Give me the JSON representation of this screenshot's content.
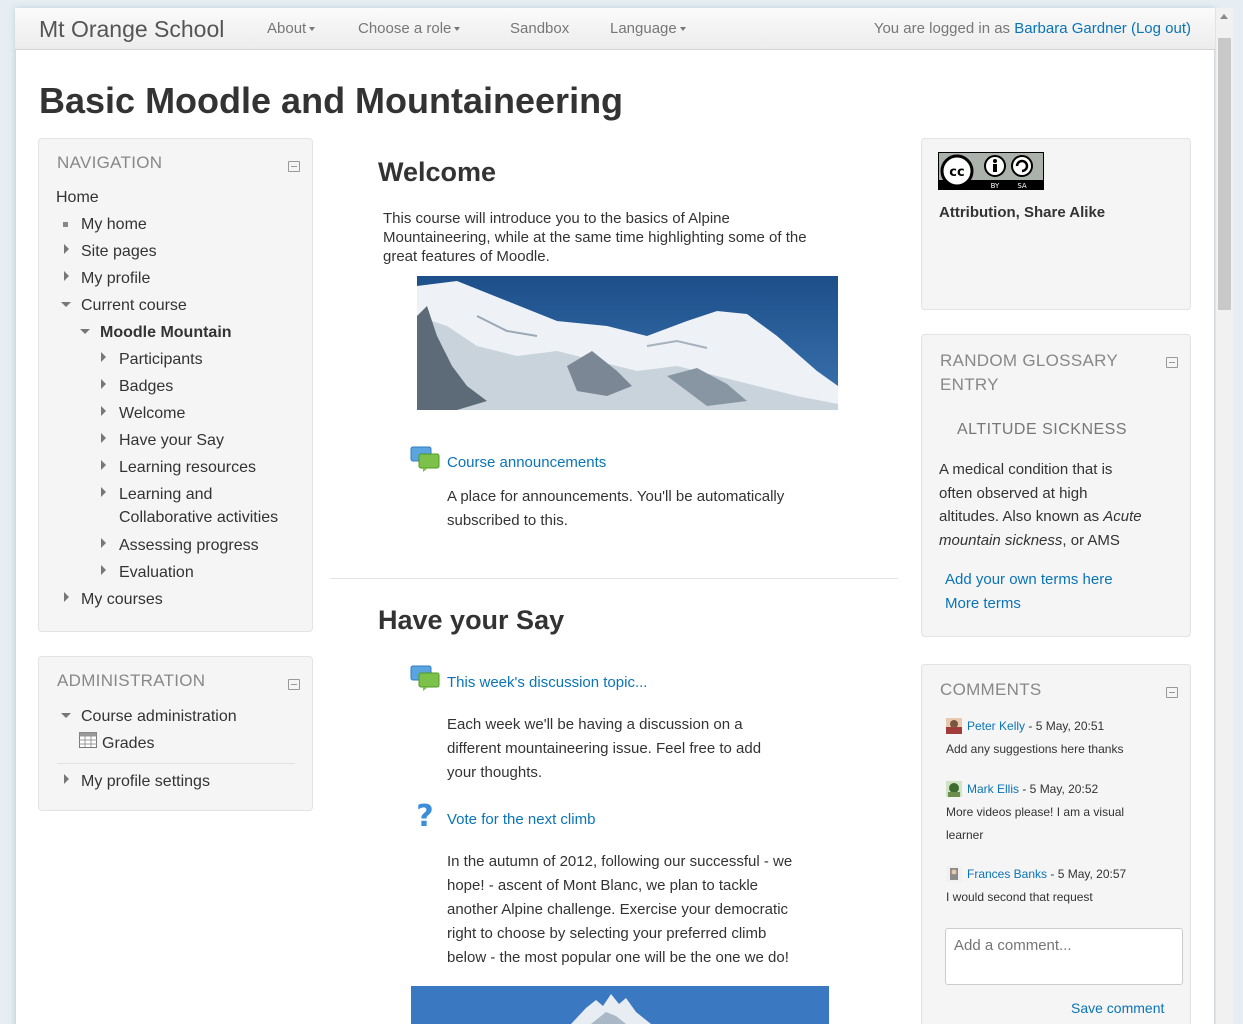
{
  "navbar": {
    "brand": "Mt Orange School",
    "items": [
      {
        "label": "About",
        "dropdown": true
      },
      {
        "label": "Choose a role",
        "dropdown": true
      },
      {
        "label": "Sandbox",
        "dropdown": false
      },
      {
        "label": "Language",
        "dropdown": true
      }
    ],
    "login_prefix": "You are logged in as ",
    "login_user": "Barbara Gardner",
    "logout": "(Log out)"
  },
  "page_title": "Basic Moodle and Mountaineering",
  "navigation": {
    "title": "NAVIGATION",
    "home": "Home",
    "items": {
      "my_home": "My home",
      "site_pages": "Site pages",
      "my_profile": "My profile",
      "current_course": "Current course",
      "course": "Moodle Mountain",
      "participants": "Participants",
      "badges": "Badges",
      "welcome": "Welcome",
      "have_your_say": "Have your Say",
      "learning_resources": "Learning resources",
      "learning_and_1": "Learning and",
      "learning_and_2": "Collaborative activities",
      "assessing_progress": "Assessing progress",
      "evaluation": "Evaluation",
      "my_courses": "My courses"
    }
  },
  "administration": {
    "title": "ADMINISTRATION",
    "course_admin": "Course administration",
    "grades": "Grades",
    "profile_settings": "My profile settings"
  },
  "welcome_section": {
    "title": "Welcome",
    "text_1": "This course will introduce you to the basics of Alpine",
    "text_2": "Mountaineering, while at the same time highlighting some of the",
    "text_3": "great features of Moodle.",
    "announcements_link": "Course announcements",
    "announcements_desc_1": "A place for announcements. You'll be automatically",
    "announcements_desc_2": "subscribed to this."
  },
  "say_section": {
    "title": "Have your Say",
    "discussion_link": "This week's discussion topic...",
    "discussion_desc_1": "Each week we'll be having a discussion on a",
    "discussion_desc_2": "different mountaineering issue. Feel free to add",
    "discussion_desc_3": "your thoughts.",
    "vote_link": "Vote for the next climb",
    "vote_desc_1": "In the autumn of 2012, following our successful - we",
    "vote_desc_2": "hope! - ascent of Mont Blanc, we plan to tackle",
    "vote_desc_3": "another Alpine challenge. Exercise your democratic",
    "vote_desc_4": "right to choose by selecting your preferred climb",
    "vote_desc_5": "below - the most popular one will be the one we do!"
  },
  "license": {
    "badge_letters": "cc BY SA",
    "caption": "Attribution, Share Alike"
  },
  "glossary": {
    "title_1": "RANDOM GLOSSARY",
    "title_2": "ENTRY",
    "term": "ALTITUDE SICKNESS",
    "def_1": "A medical condition that is",
    "def_2": "often observed at high",
    "def_3": "altitudes. Also known as ",
    "def_3_italic": "Acute",
    "def_4_italic": "mountain sickness",
    "def_4": ", or AMS",
    "add_terms": "Add your own terms here",
    "more_terms": "More terms"
  },
  "comments": {
    "title": "COMMENTS",
    "list": [
      {
        "author": "Peter Kelly",
        "date": " - 5 May, 20:51",
        "text_1": "Add any suggestions here thanks",
        "text_2": ""
      },
      {
        "author": "Mark Ellis",
        "date": " - 5 May, 20:52",
        "text_1": "More videos please! I am a visual",
        "text_2": "learner"
      },
      {
        "author": "Frances Banks",
        "date": " - 5 May, 20:57",
        "text_1": "I would second that request",
        "text_2": ""
      }
    ],
    "placeholder": "Add a comment...",
    "save": "Save comment"
  },
  "colors": {
    "link": "#0a74b8",
    "block_bg": "#f5f5f5",
    "block_title": "#888888"
  }
}
